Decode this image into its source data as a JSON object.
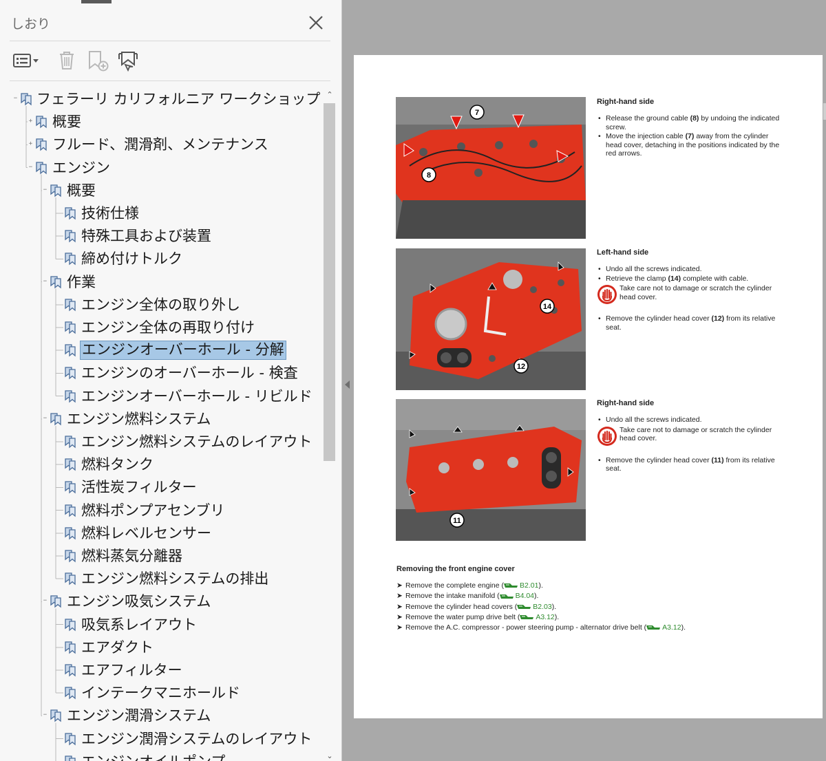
{
  "panel": {
    "title": "しおり",
    "toolbar": [
      "options-menu",
      "delete",
      "new-bookmark",
      "bookmark-from-selection"
    ]
  },
  "tree": [
    {
      "label": "フェラーリ カリフォルニア ワークショップ マニュアル",
      "level": 0,
      "expander": "-"
    },
    {
      "label": "概要",
      "level": 1,
      "expander": "+"
    },
    {
      "label": "フルード、潤滑剤、メンテナンス",
      "level": 1,
      "expander": "+"
    },
    {
      "label": "エンジン",
      "level": 1,
      "expander": "-"
    },
    {
      "label": "概要",
      "level": 2,
      "expander": "-"
    },
    {
      "label": "技術仕様",
      "level": 3,
      "expander": ""
    },
    {
      "label": "特殊工具および装置",
      "level": 3,
      "expander": ""
    },
    {
      "label": "締め付けトルク",
      "level": 3,
      "expander": ""
    },
    {
      "label": "作業",
      "level": 2,
      "expander": "-"
    },
    {
      "label": "エンジン全体の取り外し",
      "level": 3,
      "expander": ""
    },
    {
      "label": "エンジン全体の再取り付け",
      "level": 3,
      "expander": ""
    },
    {
      "label": "エンジンオーバーホール - 分解",
      "level": 3,
      "expander": "",
      "selected": true
    },
    {
      "label": "エンジンのオーバーホール - 検査",
      "level": 3,
      "expander": ""
    },
    {
      "label": "エンジンオーバーホール - リビルド",
      "level": 3,
      "expander": ""
    },
    {
      "label": "エンジン燃料システム",
      "level": 2,
      "expander": "-"
    },
    {
      "label": "エンジン燃料システムのレイアウト",
      "level": 3,
      "expander": ""
    },
    {
      "label": "燃料タンク",
      "level": 3,
      "expander": ""
    },
    {
      "label": "活性炭フィルター",
      "level": 3,
      "expander": ""
    },
    {
      "label": "燃料ポンプアセンブリ",
      "level": 3,
      "expander": ""
    },
    {
      "label": "燃料レベルセンサー",
      "level": 3,
      "expander": ""
    },
    {
      "label": "燃料蒸気分離器",
      "level": 3,
      "expander": ""
    },
    {
      "label": "エンジン燃料システムの排出",
      "level": 3,
      "expander": ""
    },
    {
      "label": "エンジン吸気システム",
      "level": 2,
      "expander": "-"
    },
    {
      "label": "吸気系レイアウト",
      "level": 3,
      "expander": ""
    },
    {
      "label": "エアダクト",
      "level": 3,
      "expander": ""
    },
    {
      "label": "エアフィルター",
      "level": 3,
      "expander": ""
    },
    {
      "label": "インテークマニホールド",
      "level": 3,
      "expander": ""
    },
    {
      "label": "エンジン潤滑システム",
      "level": 2,
      "expander": "-"
    },
    {
      "label": "エンジン潤滑システムのレイアウト",
      "level": 3,
      "expander": ""
    },
    {
      "label": "エンジンオイルポンプ",
      "level": 3,
      "expander": ""
    }
  ],
  "document": {
    "sections": [
      {
        "heading": "Right-hand side",
        "items": [
          {
            "type": "bullet",
            "parts": [
              "Release the ground cable ",
              "(8)",
              " by undoing the indicated screw."
            ]
          },
          {
            "type": "bullet",
            "parts": [
              "Move the injection cable ",
              "(7)",
              " away from the cylinder head cover, detaching in the positions indicated by the red arrows."
            ]
          }
        ]
      },
      {
        "heading": "Left-hand side",
        "items": [
          {
            "type": "bullet",
            "parts": [
              "Undo all the screws indicated.",
              "",
              ""
            ]
          },
          {
            "type": "bullet",
            "parts": [
              "Retrieve the clamp ",
              "(14)",
              " complete with cable."
            ]
          },
          {
            "type": "warning",
            "text": "Take care not to damage or scratch the cylinder head cover."
          },
          {
            "type": "bullet",
            "parts": [
              "Remove the cylinder head cover ",
              "(12)",
              " from its relative seat."
            ]
          }
        ]
      },
      {
        "heading": "Right-hand side",
        "items": [
          {
            "type": "bullet",
            "parts": [
              "Undo all the screws indicated.",
              "",
              ""
            ]
          },
          {
            "type": "warning",
            "text": "Take care not to damage or scratch the cylinder head cover."
          },
          {
            "type": "bullet",
            "parts": [
              "Remove the cylinder head cover ",
              "(11)",
              " from its relative seat."
            ]
          }
        ]
      }
    ],
    "photo_callouts": [
      [
        "7",
        "8"
      ],
      [
        "14",
        "12"
      ],
      [
        "11"
      ]
    ],
    "removing": {
      "heading": "Removing the front engine cover",
      "steps": [
        {
          "text": "Remove the complete engine (",
          "ref": "B2.01",
          "end": ")."
        },
        {
          "text": "Remove the intake manifold (",
          "ref": "B4.04",
          "end": ")."
        },
        {
          "text": "Remove the cylinder head covers (",
          "ref": "B2.03",
          "end": ")."
        },
        {
          "text": "Remove the water pump drive belt (",
          "ref": "A3.12",
          "end": ")."
        },
        {
          "text": "Remove the A.C. compressor - power steering pump - alternator drive belt (",
          "ref": "A3.12",
          "end": ")."
        }
      ]
    }
  },
  "colors": {
    "selection": "#a7c8e6",
    "engine_red": "#e0341e",
    "ref_green": "#2e8b2e"
  }
}
